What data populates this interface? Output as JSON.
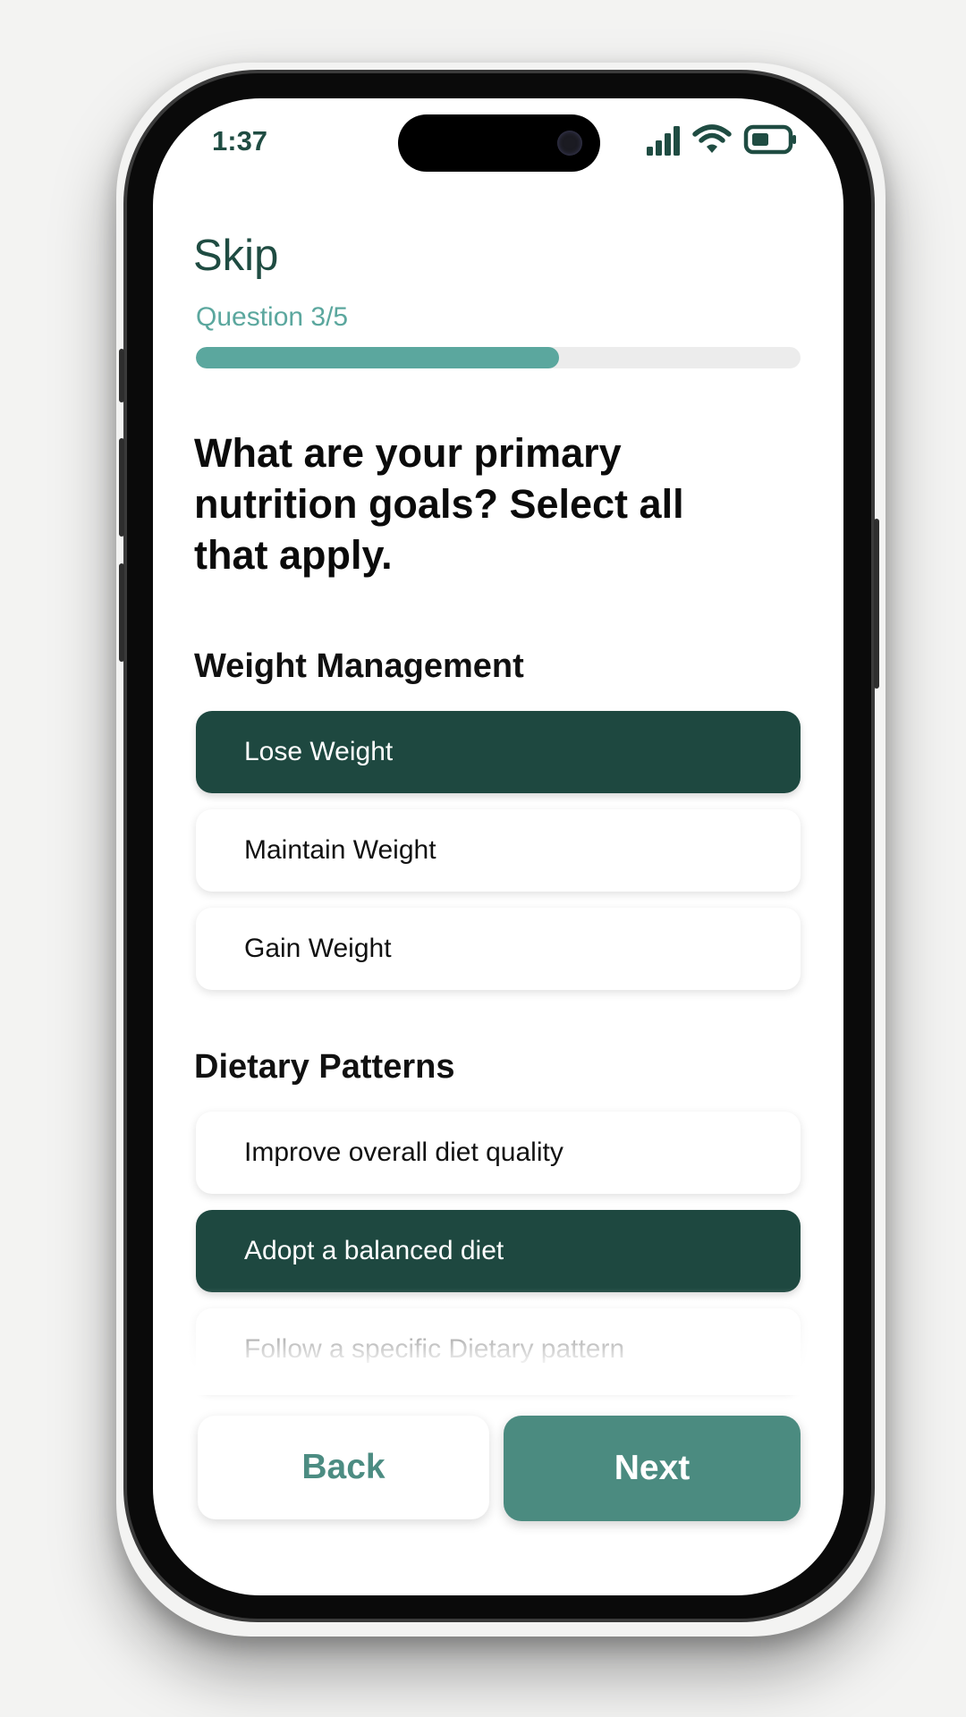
{
  "status_bar": {
    "time": "1:37",
    "icons": [
      "signal-icon",
      "wifi-icon",
      "battery-icon"
    ]
  },
  "header": {
    "skip_label": "Skip",
    "progress_label": "Question 3/5",
    "progress_fraction": 0.6
  },
  "question": {
    "text": "What are your primary nutrition goals? Select all that apply."
  },
  "sections": [
    {
      "label": "Weight Management",
      "options": [
        {
          "label": "Lose Weight",
          "selected": true
        },
        {
          "label": "Maintain Weight",
          "selected": false
        },
        {
          "label": "Gain Weight",
          "selected": false
        }
      ]
    },
    {
      "label": "Dietary Patterns",
      "options": [
        {
          "label": "Improve overall diet quality",
          "selected": false
        },
        {
          "label": "Adopt a balanced diet",
          "selected": true
        },
        {
          "label": "Follow a specific Dietary pattern",
          "selected": false
        }
      ]
    }
  ],
  "footer": {
    "back_label": "Back",
    "next_label": "Next"
  },
  "colors": {
    "primary_dark": "#1e4840",
    "accent_teal": "#5ba79e",
    "next_button": "#4b8b80"
  }
}
